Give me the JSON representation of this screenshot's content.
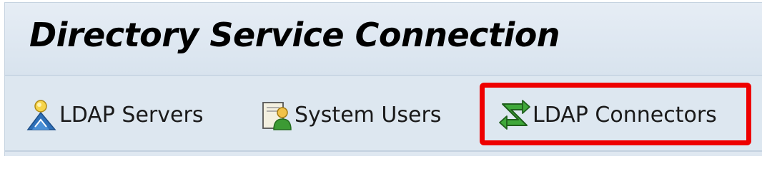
{
  "window": {
    "title": "Directory Service Connection"
  },
  "toolbar": {
    "buttons": [
      {
        "label": "LDAP Servers",
        "icon": "ldap-server-icon"
      },
      {
        "label": "System Users",
        "icon": "system-user-icon"
      },
      {
        "label": "LDAP Connectors",
        "icon": "ldap-connector-icon"
      }
    ]
  },
  "highlight": {
    "target": "LDAP Connectors",
    "color": "#ee0000"
  }
}
